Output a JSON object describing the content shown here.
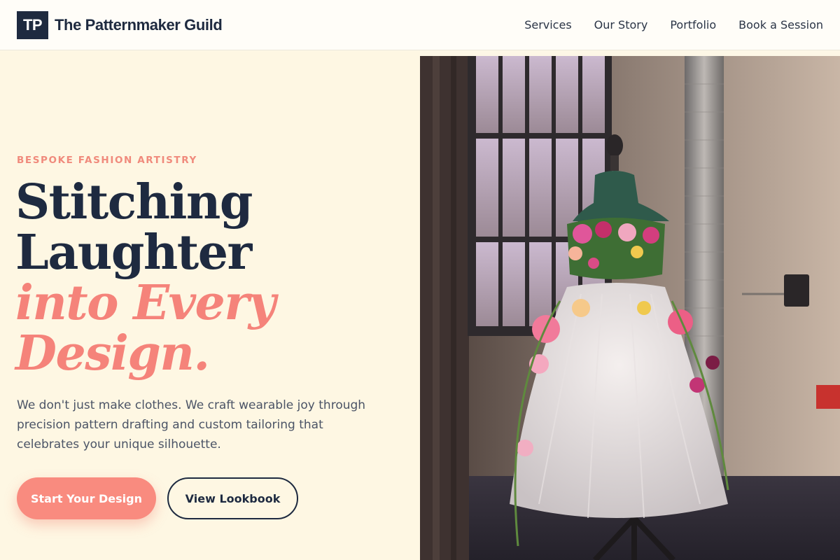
{
  "header": {
    "logo_initials": "TP",
    "brand_name": "The Patternmaker Guild",
    "nav": [
      {
        "label": "Services"
      },
      {
        "label": "Our Story"
      },
      {
        "label": "Portfolio"
      },
      {
        "label": "Book a Session"
      }
    ]
  },
  "hero": {
    "eyebrow": "BESPOKE FASHION ARTISTRY",
    "headline_line1": "Stitching",
    "headline_line2": "Laughter",
    "headline_line3": "into Every",
    "headline_line4": "Design.",
    "description": "We don't just make clothes. We craft wearable joy through precision pattern drafting and custom tailoring that celebrates your unique silhouette.",
    "primary_cta": "Start Your Design",
    "secondary_cta": "View Lookbook"
  },
  "image": {
    "subject": "dress form with floral tulle gown in industrial studio"
  },
  "colors": {
    "navy": "#1e2a40",
    "coral": "#f98b7f",
    "cream": "#fef7e3"
  }
}
